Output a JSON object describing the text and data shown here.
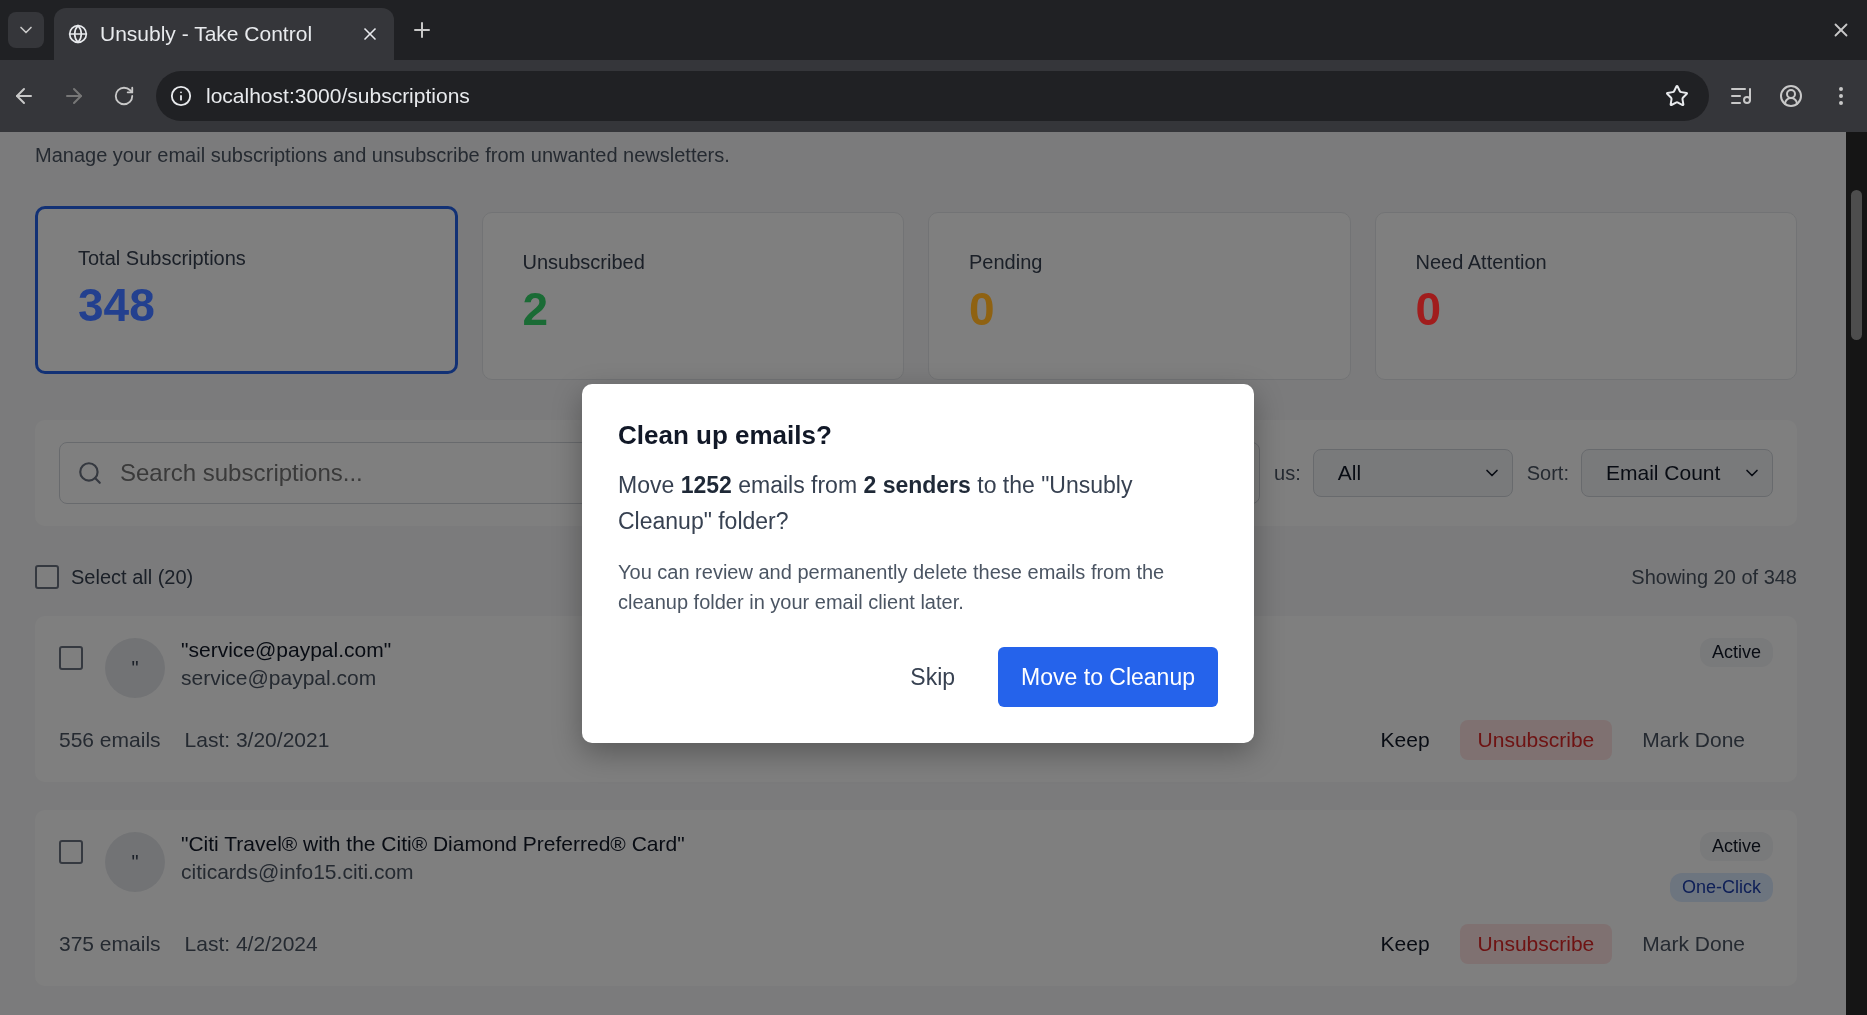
{
  "browser": {
    "tab_title": "Unsubly - Take Control",
    "url": "localhost:3000/subscriptions"
  },
  "page": {
    "subtitle": "Manage your email subscriptions and unsubscribe from unwanted newsletters.",
    "stats": [
      {
        "label": "Total Subscriptions",
        "value": "348",
        "color": "#23408f",
        "selected": true
      },
      {
        "label": "Unsubscribed",
        "value": "2",
        "color": "#1a6b35",
        "selected": false
      },
      {
        "label": "Pending",
        "value": "0",
        "color": "#8f6212",
        "selected": false
      },
      {
        "label": "Need Attention",
        "value": "0",
        "color": "#a11d1d",
        "selected": false
      }
    ],
    "search": {
      "placeholder": "Search subscriptions..."
    },
    "filters": [
      {
        "label": "us:",
        "value": "All"
      },
      {
        "label": "Sort:",
        "value": "Email Count"
      }
    ],
    "select_all": {
      "label": "Select all (20)",
      "checked": false
    },
    "showing": "Showing 20 of 348",
    "subscriptions": [
      {
        "avatar": "\"",
        "name": "\"service@paypal.com\"",
        "email": "service@paypal.com",
        "count": "556 emails",
        "last": "Last: 3/20/2021",
        "checked": false,
        "badges": [
          {
            "kind": "status",
            "text": "Active"
          }
        ],
        "actions": [
          {
            "kind": "keep",
            "label": "Keep"
          },
          {
            "kind": "unsubscribe",
            "label": "Unsubscribe"
          },
          {
            "kind": "done",
            "label": "Mark Done"
          }
        ]
      },
      {
        "avatar": "\"",
        "name": "\"Citi Travel® with the Citi® Diamond Preferred® Card\"",
        "email": "citicards@info15.citi.com",
        "count": "375 emails",
        "last": "Last: 4/2/2024",
        "checked": false,
        "badges": [
          {
            "kind": "status",
            "text": "Active"
          },
          {
            "kind": "method",
            "text": "One-Click"
          }
        ],
        "actions": [
          {
            "kind": "keep",
            "label": "Keep"
          },
          {
            "kind": "unsubscribe",
            "label": "Unsubscribe"
          },
          {
            "kind": "done",
            "label": "Mark Done"
          }
        ]
      }
    ]
  },
  "dialog": {
    "title": "Clean up emails?",
    "message": "Move **1252** emails from **2 senders** to the \"Unsubly Cleanup\" folder?",
    "note": "You can review and permanently delete these emails from the cleanup folder in your email client later.",
    "buttons": [
      {
        "kind": "secondary",
        "label": "Skip"
      },
      {
        "kind": "primary",
        "label": "Move to Cleanup"
      }
    ]
  }
}
